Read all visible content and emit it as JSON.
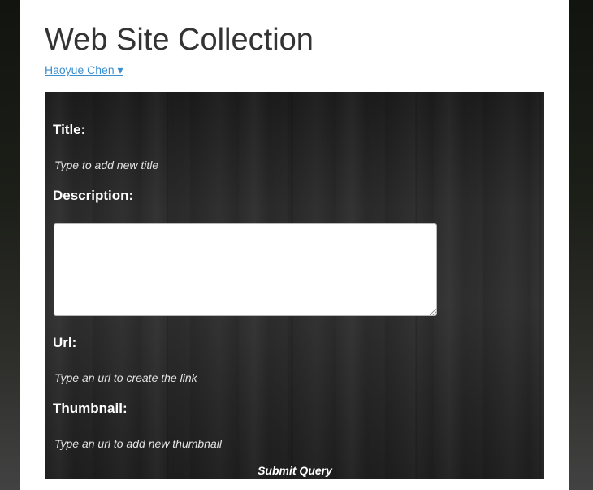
{
  "header": {
    "title": "Web Site Collection",
    "user_menu_label": "Haoyue Chen ▾"
  },
  "form": {
    "title_label": "Title:",
    "title_placeholder": "Type to add new title",
    "title_value": "",
    "description_label": "Description:",
    "description_value": "",
    "url_label": "Url:",
    "url_placeholder": "Type an url to create the link",
    "url_value": "",
    "thumbnail_label": "Thumbnail:",
    "thumbnail_placeholder": "Type an url to add new thumbnail",
    "thumbnail_value": "",
    "submit_label": "Submit Query"
  },
  "colors": {
    "link": "#3a8fd0",
    "panel": "#2a2a2a",
    "heading": "#333333"
  }
}
